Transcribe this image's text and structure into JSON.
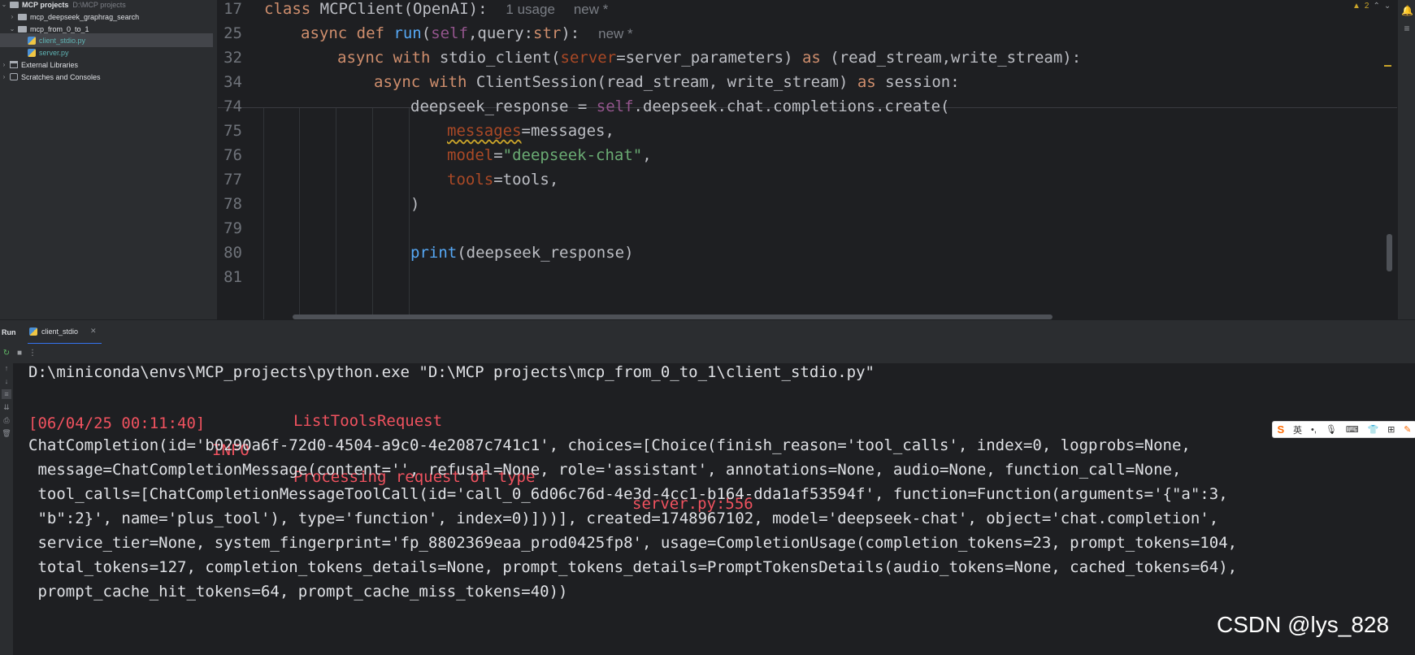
{
  "project_tree": {
    "root_label": "MCP projects",
    "root_path": "D:\\MCP projects",
    "items": [
      {
        "label": "mcp_deepseek_graphrag_search"
      },
      {
        "label": "mcp_from_0_to_1"
      },
      {
        "label": "client_stdio.py"
      },
      {
        "label": "server.py"
      },
      {
        "label": "External Libraries"
      },
      {
        "label": "Scratches and Consoles"
      }
    ]
  },
  "editor": {
    "sticky_lines": [
      {
        "no": "17",
        "hint_usage": "1 usage",
        "hint_new": "new *"
      },
      {
        "no": "25",
        "hint_new": "new *"
      },
      {
        "no": "32"
      },
      {
        "no": "34"
      }
    ],
    "lines": [
      {
        "no": "74"
      },
      {
        "no": "75"
      },
      {
        "no": "76"
      },
      {
        "no": "77"
      },
      {
        "no": "78"
      },
      {
        "no": "79"
      },
      {
        "no": "80"
      },
      {
        "no": "81"
      }
    ],
    "warnings_count": "2"
  },
  "run_panel": {
    "title": "Run",
    "tab_label": "client_stdio",
    "output": [
      "D:\\miniconda\\envs\\MCP_projects\\python.exe \"D:\\MCP projects\\mcp_from_0_to_1\\client_stdio.py\"",
      "ChatCompletion(id='b0290a6f-72d0-4504-a9c0-4e2087c741c1', choices=[Choice(finish_reason='tool_calls', index=0, logprobs=None,",
      " message=ChatCompletionMessage(content='', refusal=None, role='assistant', annotations=None, audio=None, function_call=None,",
      " tool_calls=[ChatCompletionMessageToolCall(id='call_0_6d06c76d-4e3d-4cc1-b164-dda1af53594f', function=Function(arguments='{\"a\":3,",
      " \"b\":2}', name='plus_tool'), type='function', index=0)]))], created=1748967102, model='deepseek-chat', object='chat.completion',",
      " service_tier=None, system_fingerprint='fp_8802369eaa_prod0425fp8', usage=CompletionUsage(completion_tokens=23, prompt_tokens=104,",
      " total_tokens=127, completion_tokens_details=None, prompt_tokens_details=PromptTokensDetails(audio_tokens=None, cached_tokens=64),",
      " prompt_cache_hit_tokens=64, prompt_cache_miss_tokens=40))"
    ],
    "log": {
      "timestamp": "[06/04/25 00:11:40]",
      "level": "INFO",
      "message_line1": "Processing request of type",
      "message_line2": "ListToolsRequest",
      "source": "server.py:556"
    }
  },
  "ime": {
    "logo": "S",
    "mode": "英"
  },
  "watermark": "CSDN @lys_828"
}
